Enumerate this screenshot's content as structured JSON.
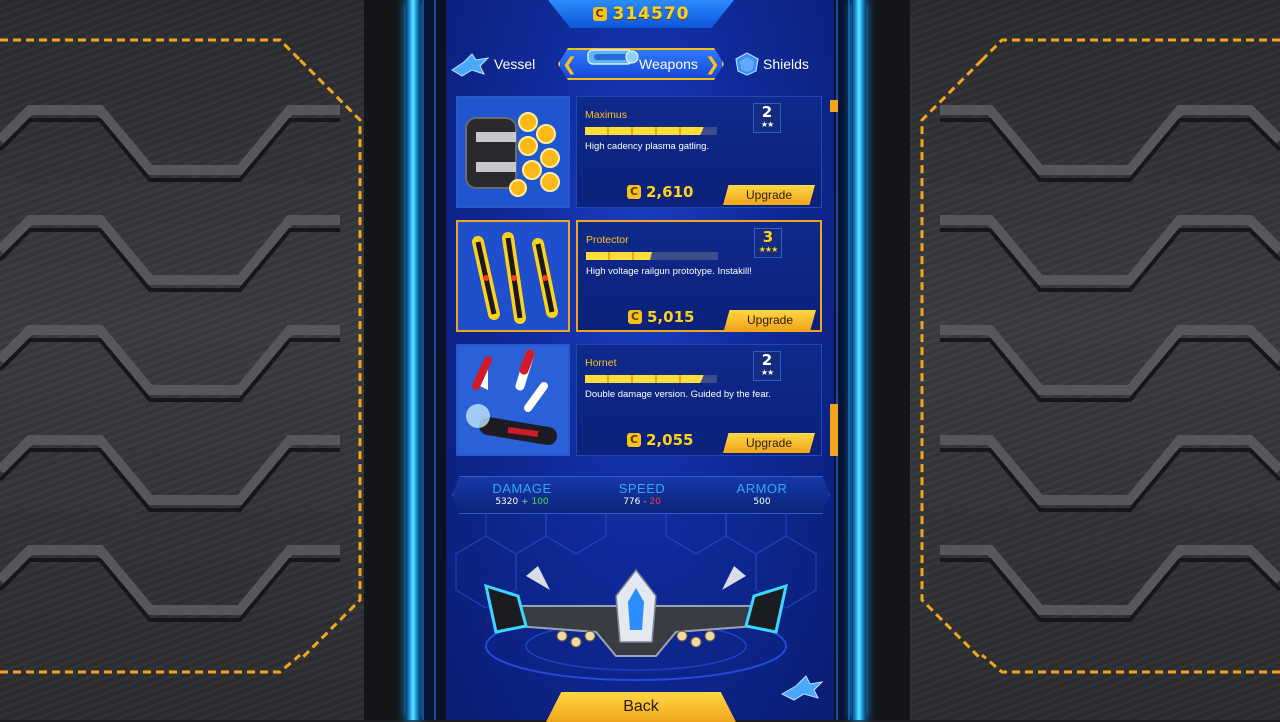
{
  "currency": {
    "amount": "314570",
    "icon": "coin-icon"
  },
  "tabs": [
    {
      "label": "Vessel",
      "icon": "vessel-icon"
    },
    {
      "label": "Weapons",
      "icon": "weapons-icon",
      "active": true
    },
    {
      "label": "Shields",
      "icon": "shields-icon"
    }
  ],
  "weapons": [
    {
      "name": "Maximus",
      "description": "High cadency plasma gatling.",
      "price": "2,610",
      "level": "2",
      "stars": "★★",
      "upgrade_label": "Upgrade",
      "bar_fill": 0.9,
      "selected": false
    },
    {
      "name": "Protector",
      "description": "High voltage railgun prototype. Instakill!",
      "price": "5,015",
      "level": "3",
      "stars": "★★★",
      "upgrade_label": "Upgrade",
      "bar_fill": 0.5,
      "selected": true
    },
    {
      "name": "Hornet",
      "description": "Double damage version. Guided by the fear.",
      "price": "2,055",
      "level": "2",
      "stars": "★★",
      "upgrade_label": "Upgrade",
      "bar_fill": 0.9,
      "selected": false
    }
  ],
  "stats": {
    "damage": {
      "label": "DAMAGE",
      "value": "5320",
      "delta_sep": " + ",
      "delta": "100"
    },
    "speed": {
      "label": "SPEED",
      "value": "776",
      "delta_sep": " - ",
      "delta": "20"
    },
    "armor": {
      "label": "ARMOR",
      "value": "500"
    }
  },
  "back_label": "Back",
  "colors": {
    "accent": "#f0a51b",
    "gold": "#ffd21a",
    "rail": "#1fb6ff",
    "screen": "#1435b0",
    "stat_label": "#2fa8ff",
    "plus": "#36e04a",
    "minus": "#ff3838"
  }
}
